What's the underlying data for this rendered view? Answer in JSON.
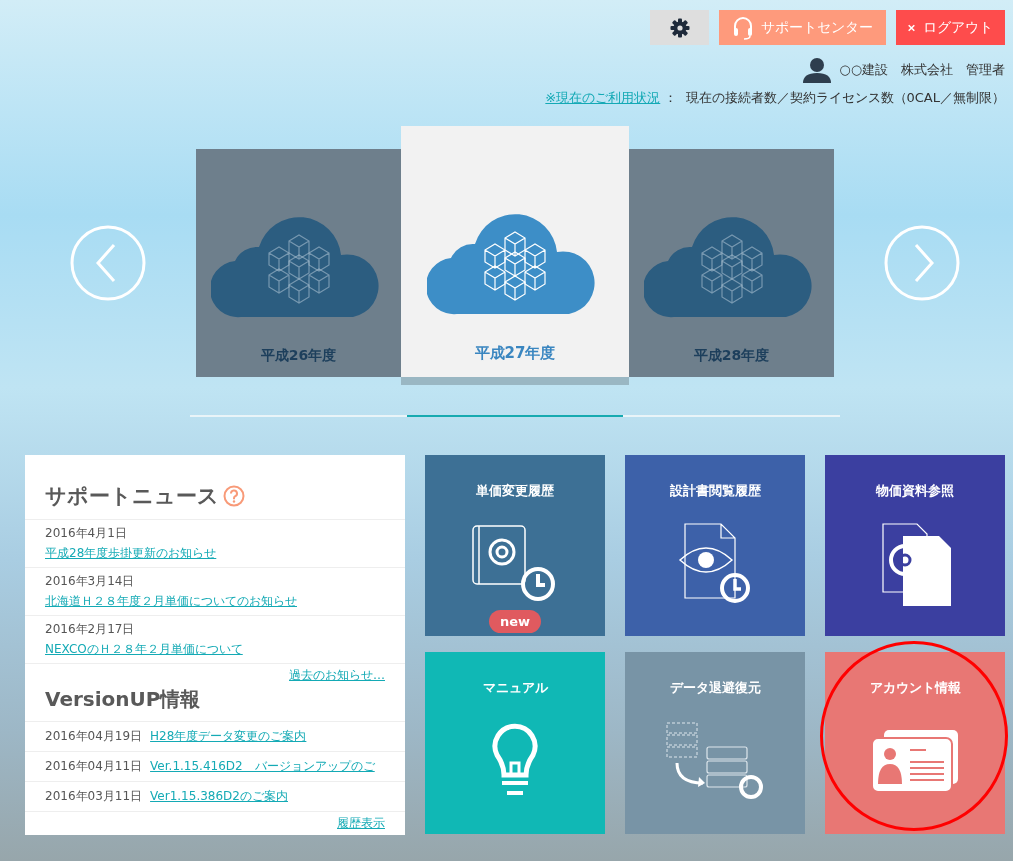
{
  "header": {
    "support_button": "サポートセンター",
    "logout_button": "ログアウト",
    "user": "○○建設　株式会社　管理者",
    "usage_link": "※現在のご利用状況",
    "usage_text": "：  現在の接続者数／契約ライセンス数（0CAL／無制限）"
  },
  "carousel": {
    "slides": [
      {
        "label": "平成26年度",
        "selected": false
      },
      {
        "label": "平成27年度",
        "selected": true
      },
      {
        "label": "平成28年度",
        "selected": false
      }
    ]
  },
  "news": {
    "title": "サポートニュース",
    "items": [
      {
        "date": "2016年4月1日",
        "title": "平成28年度歩掛更新のお知らせ"
      },
      {
        "date": "2016年3月14日",
        "title": "北海道Ｈ２８年度２月単価についてのお知らせ"
      },
      {
        "date": "2016年2月17日",
        "title": "NEXCOのＨ２８年２月単価について"
      }
    ],
    "more_link": "過去のお知らせ…",
    "version_title": "VersionUP情報",
    "version_items": [
      {
        "date": "2016年04月19日",
        "title": "H28年度データ変更のご案内"
      },
      {
        "date": "2016年04月11日",
        "title": "Ver.1.15.416D2　バージョンアップのご"
      },
      {
        "date": "2016年03月11日",
        "title": "Ver1.15.386D2のご案内"
      }
    ],
    "history_link": "履歴表示"
  },
  "tiles": [
    {
      "label": "単価変更履歴",
      "kind": "book",
      "color": "#3d7095",
      "badge": "new",
      "circled": false
    },
    {
      "label": "設計書閲覧履歴",
      "kind": "view",
      "color": "#3d61a9",
      "circled": false
    },
    {
      "label": "物価資料参照",
      "kind": "docs",
      "color": "#3b3fa0",
      "circled": false
    },
    {
      "label": "マニュアル",
      "kind": "bulb",
      "color": "#10b8b5",
      "circled": false
    },
    {
      "label": "データ退避復元",
      "kind": "restore",
      "color": "#7894a6",
      "circled": false
    },
    {
      "label": "アカウント情報",
      "kind": "account",
      "color": "#e87774",
      "circled": true
    }
  ]
}
